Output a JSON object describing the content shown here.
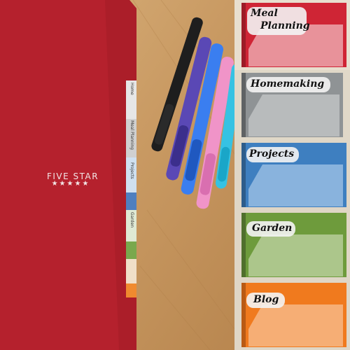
{
  "brand": {
    "name": "FIVE STAR",
    "stars": "★★★★★"
  },
  "side_tabs": [
    "Home",
    "Meal Planning",
    "Projects",
    "Garden"
  ],
  "panels": [
    {
      "label": "Meal",
      "label2": "Planning",
      "color": "#cf2535"
    },
    {
      "label": "Homemaking",
      "color": "#8f9395"
    },
    {
      "label": "Projects",
      "color": "#3e7fc0"
    },
    {
      "label": "Garden",
      "color": "#6e9b3c"
    },
    {
      "label": "Blog",
      "color": "#f07a1e"
    }
  ],
  "pens": [
    {
      "color": "#1e1e1e"
    },
    {
      "color": "#4b3fa3"
    },
    {
      "color": "#2c6fe0"
    },
    {
      "color": "#e37fb6"
    },
    {
      "color": "#2bb4d5"
    }
  ]
}
